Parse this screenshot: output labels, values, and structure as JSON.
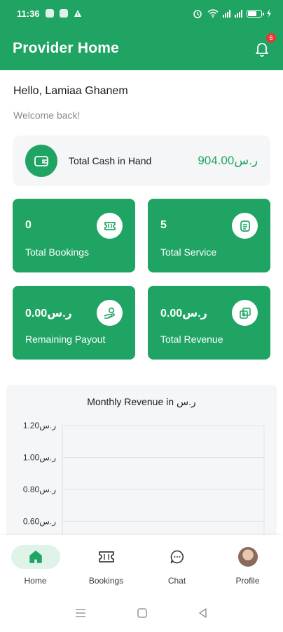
{
  "status_bar": {
    "time": "11:36"
  },
  "header": {
    "title": "Provider Home",
    "notification_count": "6"
  },
  "greeting": {
    "hello": "Hello, Lamiaa Ghanem",
    "welcome": "Welcome back!"
  },
  "cash": {
    "label": "Total Cash in Hand",
    "value": "904.00ر.س"
  },
  "stats": [
    {
      "value": "0",
      "label": "Total Bookings",
      "icon": "ticket-icon"
    },
    {
      "value": "5",
      "label": "Total Service",
      "icon": "list-icon"
    },
    {
      "value": "0.00ر.س",
      "label": "Remaining Payout",
      "icon": "hand-coin-icon"
    },
    {
      "value": "0.00ر.س",
      "label": "Total Revenue",
      "icon": "money-icon"
    }
  ],
  "chart_data": {
    "type": "line",
    "title": "Monthly Revenue in ر.س",
    "y_ticks": [
      "1.20ر.س",
      "1.00ر.س",
      "0.80ر.س",
      "0.60ر.س"
    ],
    "y_tick_values": [
      1.2,
      1.0,
      0.8,
      0.6
    ],
    "grid": true,
    "series": []
  },
  "bottom_nav": [
    {
      "label": "Home",
      "icon": "home-icon",
      "active": true
    },
    {
      "label": "Bookings",
      "icon": "ticket-icon",
      "active": false
    },
    {
      "label": "Chat",
      "icon": "chat-icon",
      "active": false
    },
    {
      "label": "Profile",
      "icon": "avatar",
      "active": false
    }
  ],
  "colors": {
    "primary": "#1fa463",
    "background": "#ffffff",
    "card_grey": "#f5f6f7",
    "badge": "#e53935"
  }
}
